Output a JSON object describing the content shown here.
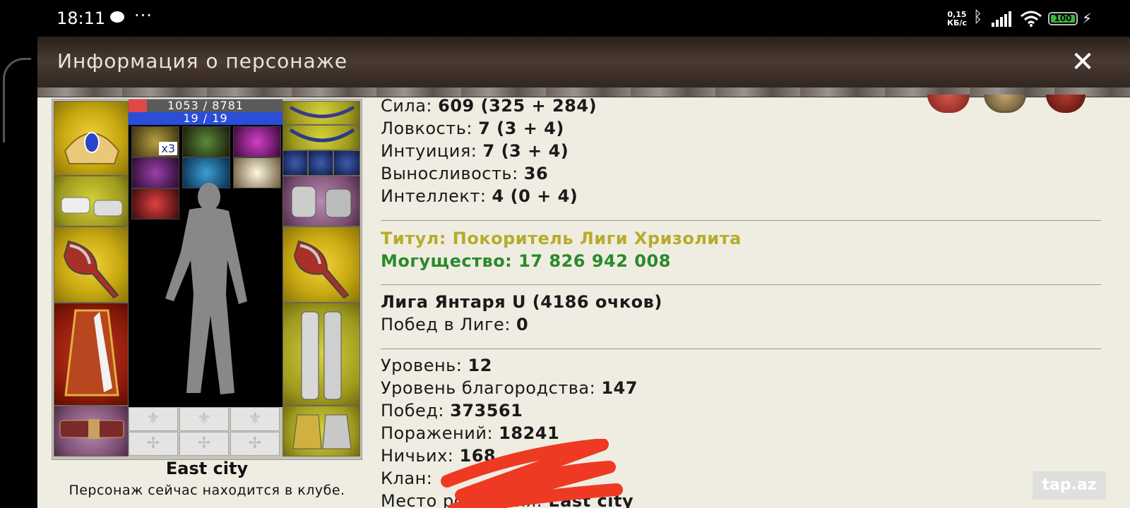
{
  "status_bar": {
    "time": "18:11",
    "dots": "···",
    "speed_value": "0,15",
    "speed_unit": "КБ/с",
    "battery": "100"
  },
  "window": {
    "title": "Информация о персонаже",
    "close_label": "✕"
  },
  "character": {
    "hp_text": "1053 / 8781",
    "hp_fraction": 0.12,
    "mp_text": "19 / 19",
    "potion_count": "x3",
    "city": "East city",
    "location_text": "Персонаж сейчас находится в клубе."
  },
  "stats": {
    "strength_label": "Сила:",
    "strength_value": "609 (325 + 284)",
    "agility_label": "Ловкость:",
    "agility_value": "7 (3 + 4)",
    "intuition_label": "Интуиция:",
    "intuition_value": "7 (3 + 4)",
    "endurance_label": "Выносливость:",
    "endurance_value": "36",
    "intellect_label": "Интеллект:",
    "intellect_value": "4 (0 + 4)"
  },
  "titles": {
    "title_text": "Титул: Покоритель Лиги Хризолита",
    "power_text": "Могущество: 17 826 942 008"
  },
  "league": {
    "league_name": "Лига Янтаря U (4186 очков)",
    "wins_label": "Побед в Лиге:",
    "wins_value": "0"
  },
  "record": {
    "level_label": "Уровень:",
    "level_value": "12",
    "nobility_label": "Уровень благородства:",
    "nobility_value": "147",
    "victories_label": "Побед:",
    "victories_value": "373561",
    "defeats_label": "Поражений:",
    "defeats_value": "18241",
    "draws_label": "Ничьих:",
    "draws_value": "168",
    "clan_label": "Клан:",
    "birthplace_label": "Место рождения:",
    "birthplace_value": "East city"
  },
  "watermark": "tap.az",
  "colors": {
    "title_gold": "#b8ab2a",
    "power_green": "#2a8a2a",
    "panel_bg": "#efede2"
  }
}
